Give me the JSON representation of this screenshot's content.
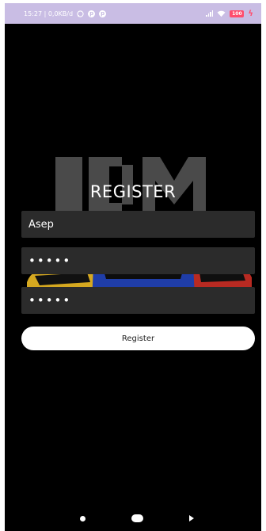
{
  "status_bar": {
    "time_and_speed": "15:27 | 0,0KB/d",
    "battery_level": "100",
    "bar_color": "#c9bde4",
    "icons": [
      "whatsapp-icon",
      "app-notification-icon",
      "app-notification-icon",
      "signal-icon",
      "wifi-icon",
      "battery-icon",
      "charging-icon"
    ]
  },
  "register": {
    "title": "REGISTER",
    "username_value": "Asep",
    "password_value": "•••••",
    "confirm_password_value": "•••••",
    "button_label": "Register"
  },
  "nav_bar": {
    "icons": [
      "menu-nav-icon",
      "home-nav-icon",
      "back-nav-icon"
    ]
  },
  "colors": {
    "background": "#000000",
    "field_background": "#2b2b2b",
    "button_background": "#ffffff",
    "text": "#ffffff"
  }
}
